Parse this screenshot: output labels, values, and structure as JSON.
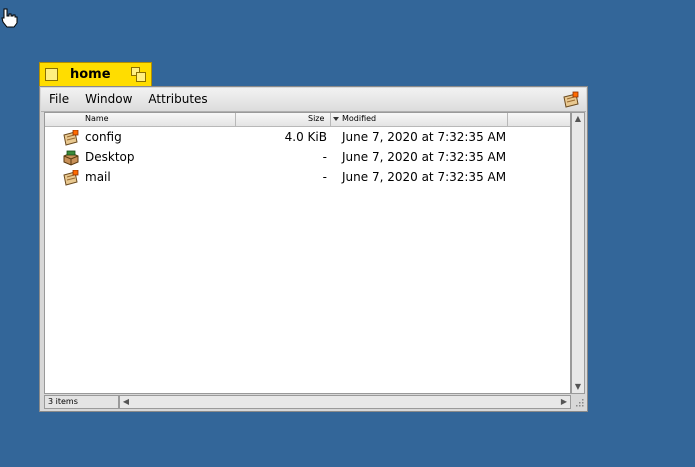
{
  "window": {
    "title": "home"
  },
  "menubar": {
    "items": [
      "File",
      "Window",
      "Attributes"
    ]
  },
  "columns": {
    "name": "Name",
    "size": "Size",
    "modified": "Modified"
  },
  "files": [
    {
      "name": "config",
      "size": "4.0 KiB",
      "modified": "June 7, 2020 at 7:32:35 AM",
      "icon": "folder-config-icon"
    },
    {
      "name": "Desktop",
      "size": "-",
      "modified": "June 7, 2020 at 7:32:35 AM",
      "icon": "desktop-folder-icon"
    },
    {
      "name": "mail",
      "size": "-",
      "modified": "June 7, 2020 at 7:32:35 AM",
      "icon": "folder-mail-icon"
    }
  ],
  "status": {
    "count": "3 items"
  },
  "colors": {
    "desktop": "#336699",
    "tab": "#ffdd00"
  }
}
